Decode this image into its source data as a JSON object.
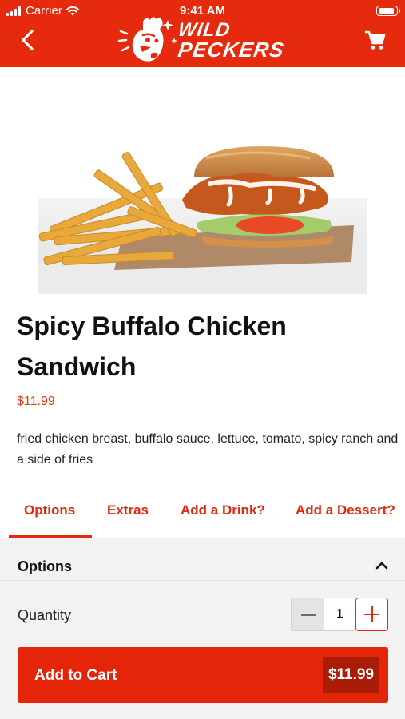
{
  "status_bar": {
    "carrier": "Carrier",
    "time": "9:41 AM",
    "battery_level": 0.9
  },
  "header": {
    "logo_line1": "WILD",
    "logo_line2": "PECKERS",
    "back_icon": "chevron-left-icon",
    "cart_icon": "shopping-cart-icon"
  },
  "product": {
    "title": "Spicy Buffalo Chicken Sandwich",
    "price": "$11.99",
    "description": "fried chicken breast, buffalo sauce, lettuce, tomato, spicy ranch and a side of fries"
  },
  "tabs": [
    {
      "label": "Options",
      "active": true
    },
    {
      "label": "Extras",
      "active": false
    },
    {
      "label": "Add a Drink?",
      "active": false
    },
    {
      "label": "Add a Dessert?",
      "active": false
    }
  ],
  "options": {
    "section_title": "Options",
    "quantity_label": "Quantity",
    "quantity_value": "1"
  },
  "cart_button": {
    "label": "Add to Cart",
    "price": "$11.99"
  },
  "colors": {
    "brand_red": "#e52a0d",
    "price_red": "#d93a19",
    "button_dark_red": "#a81c08",
    "panel_gray": "#f2f2f2"
  }
}
